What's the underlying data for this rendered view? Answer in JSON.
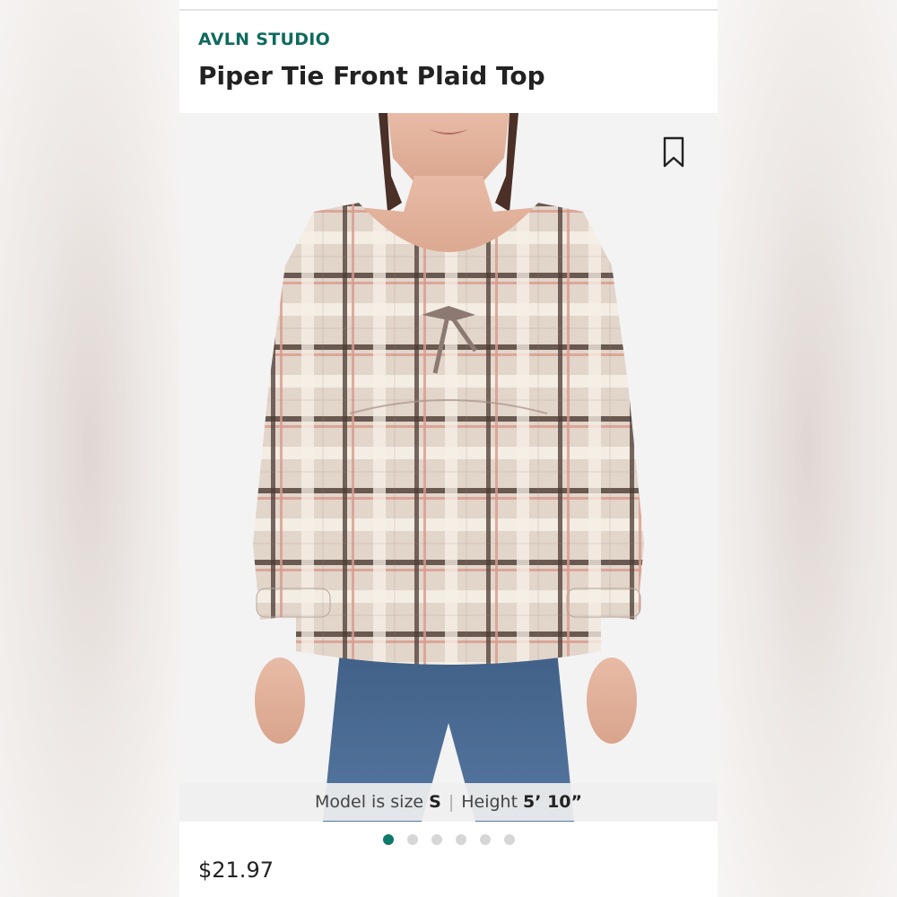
{
  "product": {
    "brand": "AVLN STUDIO",
    "title": "Piper Tie Front Plaid Top",
    "price": "$21.97"
  },
  "model_info": {
    "size_label": "Model is size",
    "size_value": "S",
    "height_label": "Height",
    "height_value": "5’ 10”"
  },
  "carousel": {
    "count": 6,
    "active_index": 0
  },
  "icons": {
    "bookmark": "bookmark-icon"
  },
  "colors": {
    "brand": "#0f6b5e",
    "active_dot": "#0f7a6c",
    "inactive_dot": "#d6d6d6"
  }
}
